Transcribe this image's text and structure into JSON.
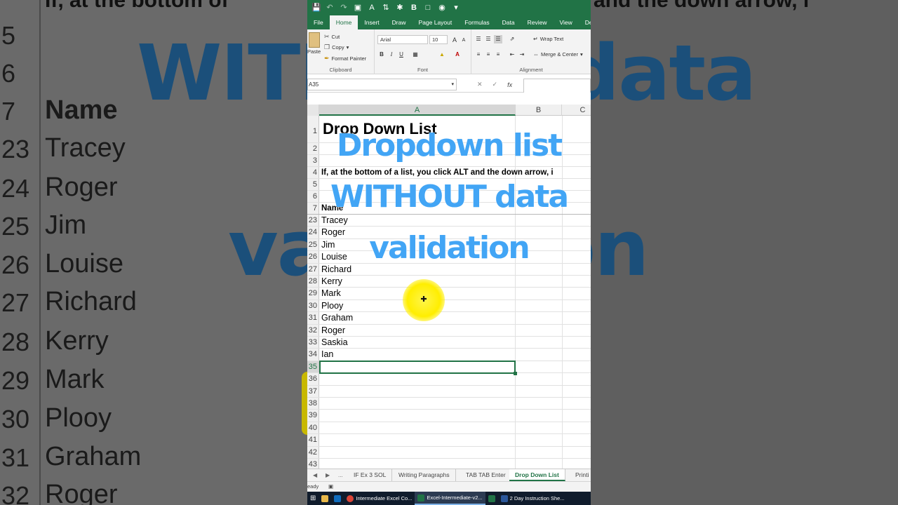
{
  "background": {
    "top_left_text": "If, at the bottom of",
    "top_right_text": "and the down arrow, i",
    "rows": [
      {
        "num": "5",
        "name": ""
      },
      {
        "num": "6",
        "name": ""
      },
      {
        "num": "7",
        "name": "Name"
      },
      {
        "num": "23",
        "name": "Tracey"
      },
      {
        "num": "24",
        "name": "Roger"
      },
      {
        "num": "25",
        "name": "Jim"
      },
      {
        "num": "26",
        "name": "Louise"
      },
      {
        "num": "27",
        "name": "Richard"
      },
      {
        "num": "28",
        "name": "Kerry"
      },
      {
        "num": "29",
        "name": "Mark"
      },
      {
        "num": "30",
        "name": "Plooy"
      },
      {
        "num": "31",
        "name": "Graham"
      },
      {
        "num": "32",
        "name": "Roger"
      }
    ],
    "big_text_1": "WITHOUT data",
    "big_text_2": "validation"
  },
  "excel": {
    "qat": {
      "bold": "B"
    },
    "tabs": [
      "File",
      "Home",
      "Insert",
      "Draw",
      "Page Layout",
      "Formulas",
      "Data",
      "Review",
      "View",
      "Deve"
    ],
    "active_tab": "Home",
    "ribbon": {
      "paste": "Paste",
      "cut": "Cut",
      "copy": "Copy",
      "format_painter": "Format Painter",
      "clipboard_label": "Clipboard",
      "font_name": "Arial",
      "font_size": "10",
      "font_label": "Font",
      "bold": "B",
      "italic": "I",
      "underline": "U",
      "wrap_text": "Wrap Text",
      "merge_center": "Merge & Center",
      "alignment_label": "Alignment",
      "grow_font": "A",
      "shrink_font": "A"
    },
    "formula_bar": {
      "name_box": "A35",
      "cancel": "✕",
      "enter": "✓",
      "fx": "fx",
      "value": ""
    },
    "columns": [
      "A",
      "B",
      "C"
    ],
    "selected_column": "A",
    "rows": [
      {
        "num": "1",
        "text": "Drop Down List",
        "style": "title"
      },
      {
        "num": "2",
        "text": "",
        "style": ""
      },
      {
        "num": "3",
        "text": "",
        "style": ""
      },
      {
        "num": "4",
        "text": "If, at the bottom of a list, you click ALT and the down arrow, i",
        "style": "bold"
      },
      {
        "num": "5",
        "text": "",
        "style": ""
      },
      {
        "num": "6",
        "text": "",
        "style": ""
      },
      {
        "num": "7",
        "text": "Name",
        "style": "bold"
      },
      {
        "num": "23",
        "text": "Tracey",
        "style": ""
      },
      {
        "num": "24",
        "text": "Roger",
        "style": ""
      },
      {
        "num": "25",
        "text": "Jim",
        "style": ""
      },
      {
        "num": "26",
        "text": "Louise",
        "style": ""
      },
      {
        "num": "27",
        "text": "Richard",
        "style": ""
      },
      {
        "num": "28",
        "text": "Kerry",
        "style": ""
      },
      {
        "num": "29",
        "text": "Mark",
        "style": ""
      },
      {
        "num": "30",
        "text": "Plooy",
        "style": ""
      },
      {
        "num": "31",
        "text": "Graham",
        "style": ""
      },
      {
        "num": "32",
        "text": "Roger",
        "style": ""
      },
      {
        "num": "33",
        "text": "Saskia",
        "style": ""
      },
      {
        "num": "34",
        "text": "Ian",
        "style": ""
      },
      {
        "num": "35",
        "text": "",
        "style": "selected"
      },
      {
        "num": "36",
        "text": "",
        "style": ""
      },
      {
        "num": "37",
        "text": "",
        "style": ""
      },
      {
        "num": "38",
        "text": "",
        "style": ""
      },
      {
        "num": "39",
        "text": "",
        "style": ""
      },
      {
        "num": "40",
        "text": "",
        "style": ""
      },
      {
        "num": "41",
        "text": "",
        "style": ""
      },
      {
        "num": "42",
        "text": "",
        "style": ""
      },
      {
        "num": "43",
        "text": "",
        "style": ""
      }
    ],
    "overlay": [
      "Dropdown list",
      "WITHOUT data",
      "validation"
    ],
    "sheet_tabs": [
      "IF Ex 3  SOL",
      "Writing Paragraphs",
      "TAB TAB Enter",
      "Drop Down List",
      "Printi"
    ],
    "active_sheet": "Drop Down List",
    "sheet_more": "...",
    "status": "eady",
    "taskbar": {
      "chrome": "Intermediate Excel Co...",
      "excel": "Excel-Intermediate-v2...",
      "word": "2 Day Instruction She..."
    }
  },
  "colors": {
    "excel_green": "#217346",
    "overlay_blue": "#42a5f5",
    "cursor_yellow": "#ffee00"
  }
}
